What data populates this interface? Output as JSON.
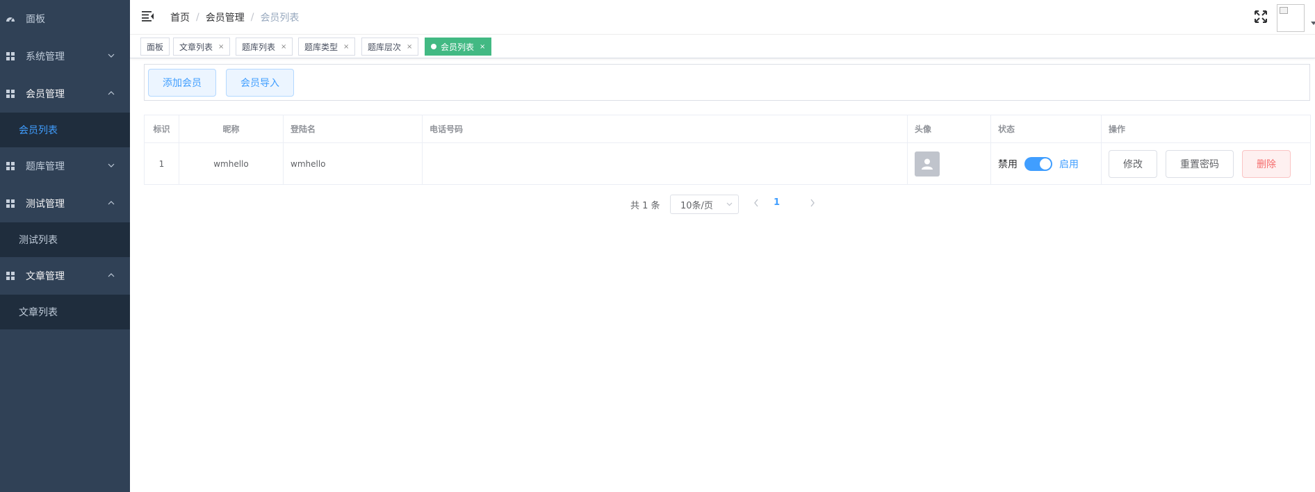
{
  "sidebar": {
    "items": [
      {
        "label": "面板"
      },
      {
        "label": "系统管理"
      },
      {
        "label": "会员管理",
        "sub": "会员列表"
      },
      {
        "label": "题库管理"
      },
      {
        "label": "测试管理",
        "sub": "测试列表"
      },
      {
        "label": "文章管理",
        "sub": "文章列表"
      }
    ]
  },
  "breadcrumb": [
    "首页",
    "/",
    "会员管理",
    "/",
    "会员列表"
  ],
  "tags": [
    "面板",
    "文章列表",
    "题库列表",
    "题库类型",
    "题库层次",
    "会员列表"
  ],
  "tag_close": "×",
  "toolbar": {
    "add_label": "添加会员",
    "import_label": "会员导入"
  },
  "table": {
    "headers": [
      "标识",
      "昵称",
      "登陆名",
      "电话号码",
      "头像",
      "状态",
      "操作"
    ],
    "rows": [
      {
        "id": "1",
        "nickname": "wmhello",
        "login": "wmhello",
        "phone": ""
      }
    ],
    "status": {
      "off": "禁用",
      "on": "启用",
      "enabled": true
    },
    "actions": {
      "edit": "修改",
      "reset": "重置密码",
      "delete": "删除"
    }
  },
  "pagination": {
    "total": "共 1 条",
    "page_size": "10条/页",
    "current": "1"
  },
  "colors": {
    "sidebar": "#304156",
    "submenu": "#1f2d3d",
    "accent": "#409eff",
    "tag_active": "#42b983",
    "danger": "#f56c6c"
  }
}
